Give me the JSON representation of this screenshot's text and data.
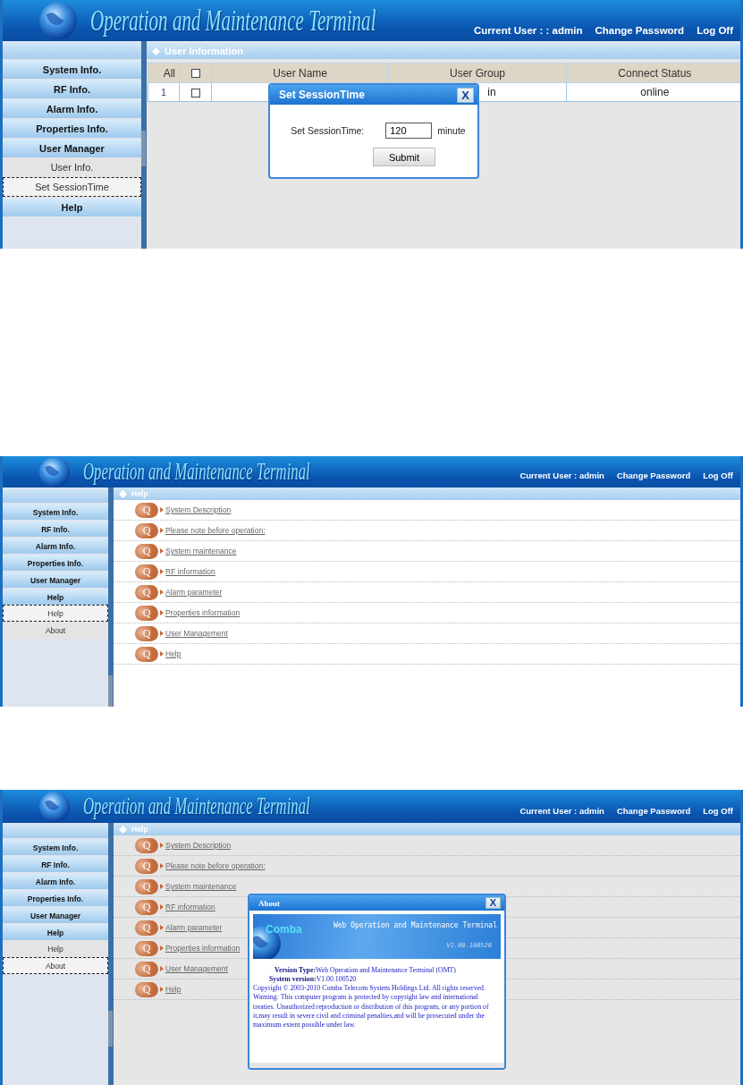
{
  "screens": [
    {
      "header": {
        "title": "Operation and Maintenance Terminal",
        "current_user": "Current User : : admin",
        "links": [
          "Change Password",
          "Log Off"
        ]
      },
      "sidebar": [
        {
          "label": "System Info.",
          "kind": "group"
        },
        {
          "label": "RF Info.",
          "kind": "group"
        },
        {
          "label": "Alarm Info.",
          "kind": "group"
        },
        {
          "label": "Properties Info.",
          "kind": "group"
        },
        {
          "label": "User Manager",
          "kind": "group"
        },
        {
          "label": "User Info.",
          "kind": "item",
          "selected": false
        },
        {
          "label": "Set SessionTime",
          "kind": "item",
          "selected": true
        },
        {
          "label": "Help",
          "kind": "group"
        }
      ],
      "panel": {
        "title": "User Information",
        "kind": "table",
        "select_all_label": "All",
        "select_all_checked": false,
        "columns": [
          "User Name",
          "User Group",
          "Connect Status"
        ],
        "rows": [
          {
            "index": "1",
            "checked": false,
            "user_group": "in",
            "connect_status": "online"
          }
        ]
      },
      "dialog": {
        "kind": "session",
        "title": "Set SessionTime",
        "close": "X",
        "label": "Set SessionTime:",
        "value": "120",
        "unit": "minute",
        "button": "Submit"
      }
    },
    {
      "header": {
        "title": "Operation and Maintenance Terminal",
        "current_user": "Current User : admin",
        "links": [
          "Change Password",
          "Log Off"
        ]
      },
      "sidebar": [
        {
          "label": "System Info.",
          "kind": "group"
        },
        {
          "label": "RF Info.",
          "kind": "group"
        },
        {
          "label": "Alarm Info.",
          "kind": "group"
        },
        {
          "label": "Properties Info.",
          "kind": "group"
        },
        {
          "label": "User Manager",
          "kind": "group"
        },
        {
          "label": "Help",
          "kind": "group"
        },
        {
          "label": "Help",
          "kind": "item",
          "selected": true
        },
        {
          "label": "About",
          "kind": "item",
          "selected": false
        }
      ],
      "panel": {
        "title": "Help",
        "kind": "help",
        "items": [
          {
            "badge": "Q",
            "label": "System Description"
          },
          {
            "badge": "Q",
            "label": "Please note before operation:"
          },
          {
            "badge": "Q",
            "label": "System maintenance"
          },
          {
            "badge": "Q",
            "label": "RF information"
          },
          {
            "badge": "Q",
            "label": "Alarm parameter"
          },
          {
            "badge": "Q",
            "label": "Properties information"
          },
          {
            "badge": "Q",
            "label": "User Management"
          },
          {
            "badge": "Q",
            "label": "Help"
          }
        ]
      }
    },
    {
      "header": {
        "title": "Operation and Maintenance Terminal",
        "current_user": "Current User : admin",
        "links": [
          "Change Password",
          "Log Off"
        ]
      },
      "sidebar": [
        {
          "label": "System Info.",
          "kind": "group"
        },
        {
          "label": "RF Info.",
          "kind": "group"
        },
        {
          "label": "Alarm Info.",
          "kind": "group"
        },
        {
          "label": "Properties Info.",
          "kind": "group"
        },
        {
          "label": "User Manager",
          "kind": "group"
        },
        {
          "label": "Help",
          "kind": "group"
        },
        {
          "label": "Help",
          "kind": "item",
          "selected": false
        },
        {
          "label": "About",
          "kind": "item",
          "selected": true
        }
      ],
      "panel": {
        "title": "Help",
        "kind": "help",
        "items": [
          {
            "badge": "Q",
            "label": "System Description"
          },
          {
            "badge": "Q",
            "label": "Please note before operation:"
          },
          {
            "badge": "Q",
            "label": "System maintenance"
          },
          {
            "badge": "Q",
            "label": "RF information"
          },
          {
            "badge": "Q",
            "label": "Alarm parameter"
          },
          {
            "badge": "Q",
            "label": "Properties information"
          },
          {
            "badge": "Q",
            "label": "User Management"
          },
          {
            "badge": "Q",
            "label": "Help"
          }
        ]
      },
      "dialog": {
        "kind": "about",
        "title": "About",
        "close": "X",
        "banner": {
          "brand": "Comba",
          "title": "Web Operation and Maintenance Terminal",
          "version": "V1.00.100520"
        },
        "lines": [
          "**Version Type:**Web Operation and Maintenance Terminal (OMT)",
          "**System version:**V1.00.100520"
        ],
        "paragraphs": [
          "Copyright © 2003-2010 Comba Telecom System Holdings Ltd. All rights reserved.",
          "Warning: This computer program is protected by copyright law and international treaties. Unauthorized reproduction or distribution of this program, or any portion of it,may result in severe civil and criminal penalties,and will be prosecuted under the maximum extent possible under law."
        ]
      }
    }
  ]
}
